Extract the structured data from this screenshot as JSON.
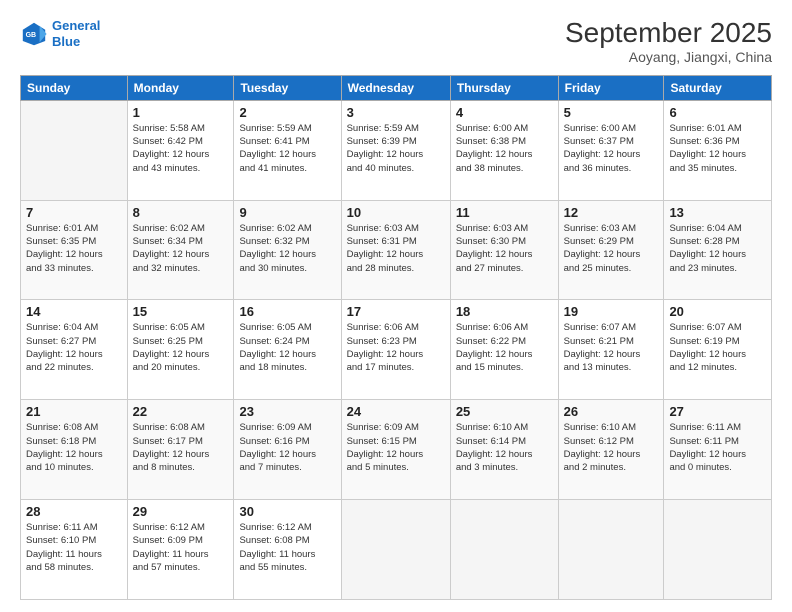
{
  "logo": {
    "line1": "General",
    "line2": "Blue"
  },
  "title": "September 2025",
  "subtitle": "Aoyang, Jiangxi, China",
  "weekdays": [
    "Sunday",
    "Monday",
    "Tuesday",
    "Wednesday",
    "Thursday",
    "Friday",
    "Saturday"
  ],
  "weeks": [
    [
      {
        "day": "",
        "info": ""
      },
      {
        "day": "1",
        "info": "Sunrise: 5:58 AM\nSunset: 6:42 PM\nDaylight: 12 hours\nand 43 minutes."
      },
      {
        "day": "2",
        "info": "Sunrise: 5:59 AM\nSunset: 6:41 PM\nDaylight: 12 hours\nand 41 minutes."
      },
      {
        "day": "3",
        "info": "Sunrise: 5:59 AM\nSunset: 6:39 PM\nDaylight: 12 hours\nand 40 minutes."
      },
      {
        "day": "4",
        "info": "Sunrise: 6:00 AM\nSunset: 6:38 PM\nDaylight: 12 hours\nand 38 minutes."
      },
      {
        "day": "5",
        "info": "Sunrise: 6:00 AM\nSunset: 6:37 PM\nDaylight: 12 hours\nand 36 minutes."
      },
      {
        "day": "6",
        "info": "Sunrise: 6:01 AM\nSunset: 6:36 PM\nDaylight: 12 hours\nand 35 minutes."
      }
    ],
    [
      {
        "day": "7",
        "info": "Sunrise: 6:01 AM\nSunset: 6:35 PM\nDaylight: 12 hours\nand 33 minutes."
      },
      {
        "day": "8",
        "info": "Sunrise: 6:02 AM\nSunset: 6:34 PM\nDaylight: 12 hours\nand 32 minutes."
      },
      {
        "day": "9",
        "info": "Sunrise: 6:02 AM\nSunset: 6:32 PM\nDaylight: 12 hours\nand 30 minutes."
      },
      {
        "day": "10",
        "info": "Sunrise: 6:03 AM\nSunset: 6:31 PM\nDaylight: 12 hours\nand 28 minutes."
      },
      {
        "day": "11",
        "info": "Sunrise: 6:03 AM\nSunset: 6:30 PM\nDaylight: 12 hours\nand 27 minutes."
      },
      {
        "day": "12",
        "info": "Sunrise: 6:03 AM\nSunset: 6:29 PM\nDaylight: 12 hours\nand 25 minutes."
      },
      {
        "day": "13",
        "info": "Sunrise: 6:04 AM\nSunset: 6:28 PM\nDaylight: 12 hours\nand 23 minutes."
      }
    ],
    [
      {
        "day": "14",
        "info": "Sunrise: 6:04 AM\nSunset: 6:27 PM\nDaylight: 12 hours\nand 22 minutes."
      },
      {
        "day": "15",
        "info": "Sunrise: 6:05 AM\nSunset: 6:25 PM\nDaylight: 12 hours\nand 20 minutes."
      },
      {
        "day": "16",
        "info": "Sunrise: 6:05 AM\nSunset: 6:24 PM\nDaylight: 12 hours\nand 18 minutes."
      },
      {
        "day": "17",
        "info": "Sunrise: 6:06 AM\nSunset: 6:23 PM\nDaylight: 12 hours\nand 17 minutes."
      },
      {
        "day": "18",
        "info": "Sunrise: 6:06 AM\nSunset: 6:22 PM\nDaylight: 12 hours\nand 15 minutes."
      },
      {
        "day": "19",
        "info": "Sunrise: 6:07 AM\nSunset: 6:21 PM\nDaylight: 12 hours\nand 13 minutes."
      },
      {
        "day": "20",
        "info": "Sunrise: 6:07 AM\nSunset: 6:19 PM\nDaylight: 12 hours\nand 12 minutes."
      }
    ],
    [
      {
        "day": "21",
        "info": "Sunrise: 6:08 AM\nSunset: 6:18 PM\nDaylight: 12 hours\nand 10 minutes."
      },
      {
        "day": "22",
        "info": "Sunrise: 6:08 AM\nSunset: 6:17 PM\nDaylight: 12 hours\nand 8 minutes."
      },
      {
        "day": "23",
        "info": "Sunrise: 6:09 AM\nSunset: 6:16 PM\nDaylight: 12 hours\nand 7 minutes."
      },
      {
        "day": "24",
        "info": "Sunrise: 6:09 AM\nSunset: 6:15 PM\nDaylight: 12 hours\nand 5 minutes."
      },
      {
        "day": "25",
        "info": "Sunrise: 6:10 AM\nSunset: 6:14 PM\nDaylight: 12 hours\nand 3 minutes."
      },
      {
        "day": "26",
        "info": "Sunrise: 6:10 AM\nSunset: 6:12 PM\nDaylight: 12 hours\nand 2 minutes."
      },
      {
        "day": "27",
        "info": "Sunrise: 6:11 AM\nSunset: 6:11 PM\nDaylight: 12 hours\nand 0 minutes."
      }
    ],
    [
      {
        "day": "28",
        "info": "Sunrise: 6:11 AM\nSunset: 6:10 PM\nDaylight: 11 hours\nand 58 minutes."
      },
      {
        "day": "29",
        "info": "Sunrise: 6:12 AM\nSunset: 6:09 PM\nDaylight: 11 hours\nand 57 minutes."
      },
      {
        "day": "30",
        "info": "Sunrise: 6:12 AM\nSunset: 6:08 PM\nDaylight: 11 hours\nand 55 minutes."
      },
      {
        "day": "",
        "info": ""
      },
      {
        "day": "",
        "info": ""
      },
      {
        "day": "",
        "info": ""
      },
      {
        "day": "",
        "info": ""
      }
    ]
  ]
}
